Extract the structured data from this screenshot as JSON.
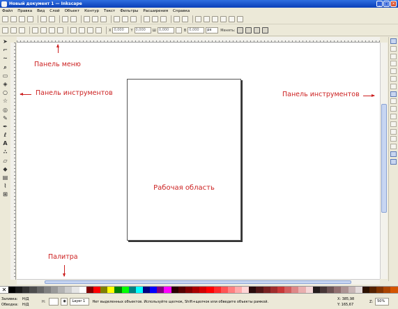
{
  "window": {
    "title": "Новый документ 1 — Inkscape"
  },
  "menu": [
    "Файл",
    "Правка",
    "Вид",
    "Слой",
    "Объект",
    "Контур",
    "Текст",
    "Фильтры",
    "Расширения",
    "Справка"
  ],
  "toolbar_controls": {
    "x_value": "0,000",
    "y_value": "0,000",
    "w_label": "Ш",
    "w_value": "0,000",
    "h_label": "В",
    "h_value": "0,000",
    "unit": "px",
    "transform_label": "Менять:"
  },
  "annotations": {
    "menu_panel": "Панель меню",
    "tools_left": "Панель инструментов",
    "tools_right": "Панель инструментов",
    "work_area": "Рабочая область",
    "palette": "Палитра"
  },
  "status": {
    "fill_label": "Заливка:",
    "fill_value": "Н/Д",
    "stroke_label": "Обводка:",
    "stroke_value": "Н/Д",
    "opacity_label": "H:",
    "layer": "Layer 1",
    "message": "Нет выделенных объектов. Используйте щелчок, Shift+щелчок или обведите объекты рамкой.",
    "x_coord": "X: 385,98",
    "y_coord": "Y: 165,67",
    "zoom_label": "Z:",
    "zoom_value": "50%"
  },
  "tool_icons": [
    "selector-icon",
    "node-icon",
    "tweak-icon",
    "zoom-icon",
    "rect-icon",
    "3dbox-icon",
    "ellipse-icon",
    "star-icon",
    "spiral-icon",
    "pencil-icon",
    "pen-icon",
    "calligraphy-icon",
    "text-icon",
    "spray-icon",
    "eraser-icon",
    "bucket-icon",
    "gradient-icon",
    "dropper-icon",
    "connector-icon"
  ],
  "palette_colors": [
    "#000000",
    "#1a1a1a",
    "#333333",
    "#4d4d4d",
    "#666666",
    "#808080",
    "#999999",
    "#b3b3b3",
    "#cccccc",
    "#e6e6e6",
    "#ffffff",
    "#800000",
    "#ff0000",
    "#808000",
    "#ffff00",
    "#008000",
    "#00ff00",
    "#008080",
    "#00ffff",
    "#000080",
    "#0000ff",
    "#800080",
    "#ff00ff",
    "#2b0000",
    "#550000",
    "#800000",
    "#aa0000",
    "#d40000",
    "#ff0000",
    "#ff2a2a",
    "#ff5555",
    "#ff8080",
    "#ffaaaa",
    "#ffd5d5",
    "#280b0b",
    "#501616",
    "#782121",
    "#a02c2c",
    "#c83737",
    "#d35f5f",
    "#de8787",
    "#e9afaf",
    "#f4d7d7",
    "#241c1c",
    "#483737",
    "#6c5353",
    "#916f6f",
    "#ac9393",
    "#c8b7b7",
    "#e3dbdb",
    "#2b1100",
    "#552200",
    "#803300",
    "#aa4400",
    "#d45500"
  ]
}
